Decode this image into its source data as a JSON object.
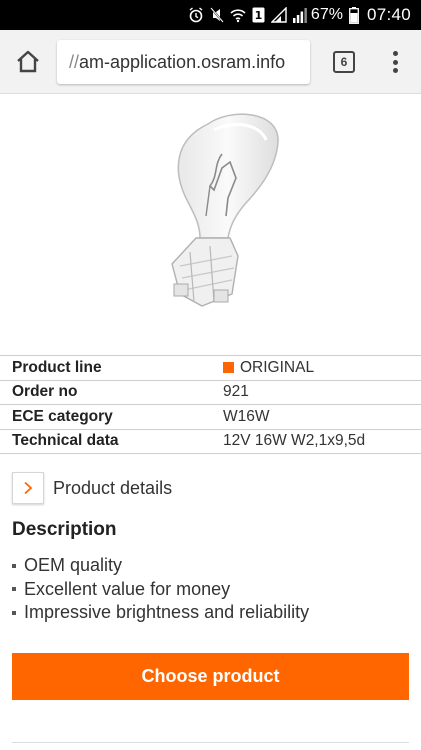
{
  "status_bar": {
    "battery_percent": "67%",
    "time": "07:40",
    "sim_badge": "1",
    "icons": [
      "alarm-icon",
      "mute-icon",
      "wifi-icon",
      "sim-icon",
      "signal-icon",
      "battery-icon"
    ]
  },
  "browser": {
    "url_slashes": "//",
    "url": "am-application.osram.info",
    "tab_count": "6",
    "icons": [
      "home-icon",
      "tabs-icon",
      "overflow-menu-icon"
    ]
  },
  "product": {
    "image_icon": "w16w-bulb-image",
    "specs": [
      {
        "label": "Product line",
        "value": "ORIGINAL",
        "marker": true
      },
      {
        "label": "Order no",
        "value": "921",
        "marker": false
      },
      {
        "label": "ECE category",
        "value": "W16W",
        "marker": false
      },
      {
        "label": "Technical data",
        "value": "12V 16W W2,1x9,5d",
        "marker": false
      }
    ],
    "details_link": "Product details",
    "description_heading": "Description",
    "features": [
      "OEM quality",
      "Excellent value for money",
      "Impressive brightness and reliability"
    ],
    "choose_button": "Choose product"
  },
  "colors": {
    "accent": "#ff6600",
    "status_bar": "#000000",
    "toolbar": "#f2f2f2"
  }
}
